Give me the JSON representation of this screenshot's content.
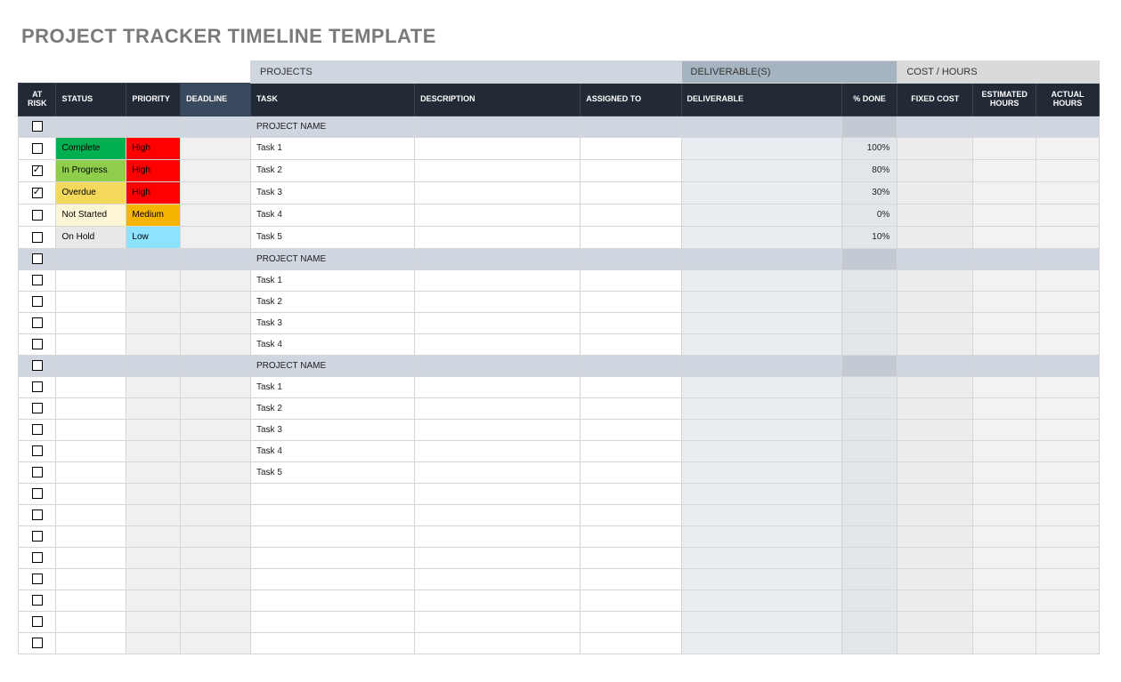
{
  "title": "PROJECT TRACKER TIMELINE TEMPLATE",
  "group_headers": {
    "projects": "PROJECTS",
    "deliverables": "DELIVERABLE(S)",
    "cost": "COST / HOURS"
  },
  "columns": {
    "at_risk": "AT RISK",
    "status": "STATUS",
    "priority": "PRIORITY",
    "deadline": "DEADLINE",
    "task": "TASK",
    "description": "DESCRIPTION",
    "assigned_to": "ASSIGNED TO",
    "deliverable": "DELIVERABLE",
    "pct_done": "% DONE",
    "fixed_cost": "FIXED COST",
    "est_hours": "ESTIMATED HOURS",
    "actual_hours": "ACTUAL HOURS"
  },
  "status_styles": {
    "Complete": "st-complete",
    "In Progress": "st-inprogress",
    "Overdue": "st-overdue",
    "Not Started": "st-notstarted",
    "On Hold": "st-onhold"
  },
  "priority_styles": {
    "High": "pr-high",
    "Medium": "pr-medium",
    "Low": "pr-low"
  },
  "rows": [
    {
      "type": "section",
      "task": "PROJECT NAME",
      "at_risk": false
    },
    {
      "type": "task",
      "at_risk": false,
      "status": "Complete",
      "priority": "High",
      "task": "Task 1",
      "pct_done": "100%"
    },
    {
      "type": "task",
      "at_risk": true,
      "status": "In Progress",
      "priority": "High",
      "task": "Task 2",
      "pct_done": "80%"
    },
    {
      "type": "task",
      "at_risk": true,
      "status": "Overdue",
      "priority": "High",
      "task": "Task 3",
      "pct_done": "30%"
    },
    {
      "type": "task",
      "at_risk": false,
      "status": "Not Started",
      "priority": "Medium",
      "task": "Task 4",
      "pct_done": "0%"
    },
    {
      "type": "task",
      "at_risk": false,
      "status": "On Hold",
      "priority": "Low",
      "task": "Task 5",
      "pct_done": "10%"
    },
    {
      "type": "section",
      "task": "PROJECT NAME",
      "at_risk": false
    },
    {
      "type": "task",
      "at_risk": false,
      "task": "Task 1"
    },
    {
      "type": "task",
      "at_risk": false,
      "task": "Task 2"
    },
    {
      "type": "task",
      "at_risk": false,
      "task": "Task 3"
    },
    {
      "type": "task",
      "at_risk": false,
      "task": "Task 4"
    },
    {
      "type": "section",
      "task": "PROJECT NAME",
      "at_risk": false
    },
    {
      "type": "task",
      "at_risk": false,
      "task": "Task 1"
    },
    {
      "type": "task",
      "at_risk": false,
      "task": "Task 2"
    },
    {
      "type": "task",
      "at_risk": false,
      "task": "Task 3"
    },
    {
      "type": "task",
      "at_risk": false,
      "task": "Task 4"
    },
    {
      "type": "task",
      "at_risk": false,
      "task": "Task 5"
    },
    {
      "type": "task",
      "at_risk": false
    },
    {
      "type": "task",
      "at_risk": false
    },
    {
      "type": "task",
      "at_risk": false
    },
    {
      "type": "task",
      "at_risk": false
    },
    {
      "type": "task",
      "at_risk": false
    },
    {
      "type": "task",
      "at_risk": false
    },
    {
      "type": "task",
      "at_risk": false
    },
    {
      "type": "task",
      "at_risk": false
    }
  ]
}
